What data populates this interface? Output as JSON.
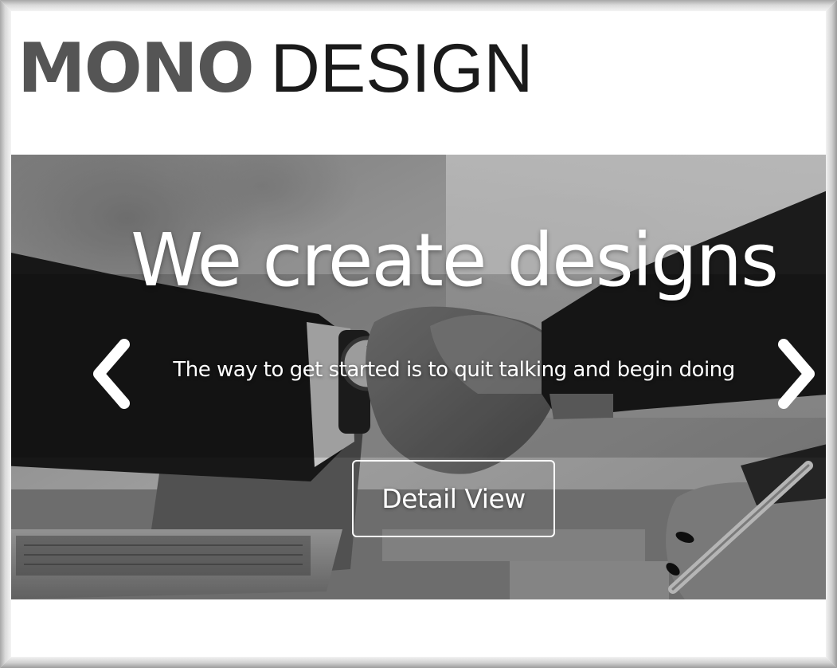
{
  "header": {
    "logo_bold": "MONO",
    "logo_light": "DESIGN"
  },
  "hero": {
    "title": "We create designs",
    "subtitle": "The way to get started is to quit talking and begin doing",
    "button_label": "Detail View",
    "prev_icon": "chevron-left-icon",
    "next_icon": "chevron-right-icon",
    "background_image": "handshake-over-laptop-desk (grayscale photo)"
  },
  "colors": {
    "logo_bold": "#555555",
    "logo_light": "#1a1a1a",
    "hero_text": "#ffffff",
    "frame": "#c8c8c8"
  }
}
